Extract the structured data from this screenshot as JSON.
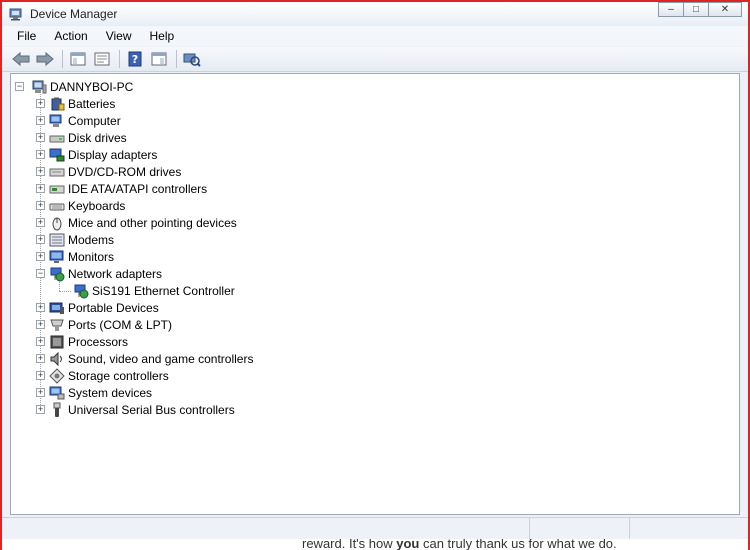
{
  "window": {
    "title": "Device Manager",
    "icon": "device-manager-icon"
  },
  "window_controls": {
    "minimize": "–",
    "maximize": "□",
    "close": "✕"
  },
  "menu": [
    "File",
    "Action",
    "View",
    "Help"
  ],
  "toolbar": [
    "back-arrow-icon",
    "forward-arrow-icon",
    "show-hide-console-tree-icon",
    "properties-icon",
    "help-icon",
    "action-pane-icon",
    "scan-hardware-changes-icon"
  ],
  "tree": {
    "root": {
      "label": "DANNYBOI-PC",
      "icon": "computer-icon"
    },
    "items": [
      {
        "label": "Batteries",
        "icon": "battery-icon",
        "expanded": false
      },
      {
        "label": "Computer",
        "icon": "computer-icon",
        "expanded": false
      },
      {
        "label": "Disk drives",
        "icon": "disk-drive-icon",
        "expanded": false
      },
      {
        "label": "Display adapters",
        "icon": "display-adapter-icon",
        "expanded": false
      },
      {
        "label": "DVD/CD-ROM drives",
        "icon": "dvd-drive-icon",
        "expanded": false
      },
      {
        "label": "IDE ATA/ATAPI controllers",
        "icon": "ide-controller-icon",
        "expanded": false
      },
      {
        "label": "Keyboards",
        "icon": "keyboard-icon",
        "expanded": false
      },
      {
        "label": "Mice and other pointing devices",
        "icon": "mouse-icon",
        "expanded": false
      },
      {
        "label": "Modems",
        "icon": "modem-icon",
        "expanded": false
      },
      {
        "label": "Monitors",
        "icon": "monitor-icon",
        "expanded": false
      },
      {
        "label": "Network adapters",
        "icon": "network-adapter-icon",
        "expanded": true,
        "children": [
          {
            "label": "SiS191 Ethernet Controller",
            "icon": "network-adapter-icon"
          }
        ]
      },
      {
        "label": "Portable Devices",
        "icon": "portable-device-icon",
        "expanded": false
      },
      {
        "label": "Ports (COM & LPT)",
        "icon": "port-icon",
        "expanded": false
      },
      {
        "label": "Processors",
        "icon": "processor-icon",
        "expanded": false
      },
      {
        "label": "Sound, video and game controllers",
        "icon": "sound-icon",
        "expanded": false
      },
      {
        "label": "Storage controllers",
        "icon": "storage-controller-icon",
        "expanded": false
      },
      {
        "label": "System devices",
        "icon": "system-device-icon",
        "expanded": false
      },
      {
        "label": "Universal Serial Bus controllers",
        "icon": "usb-icon",
        "expanded": false
      }
    ]
  },
  "background_text": {
    "before": "reward. It's how ",
    "bold": "you",
    "after": " can truly thank us for what we do."
  }
}
